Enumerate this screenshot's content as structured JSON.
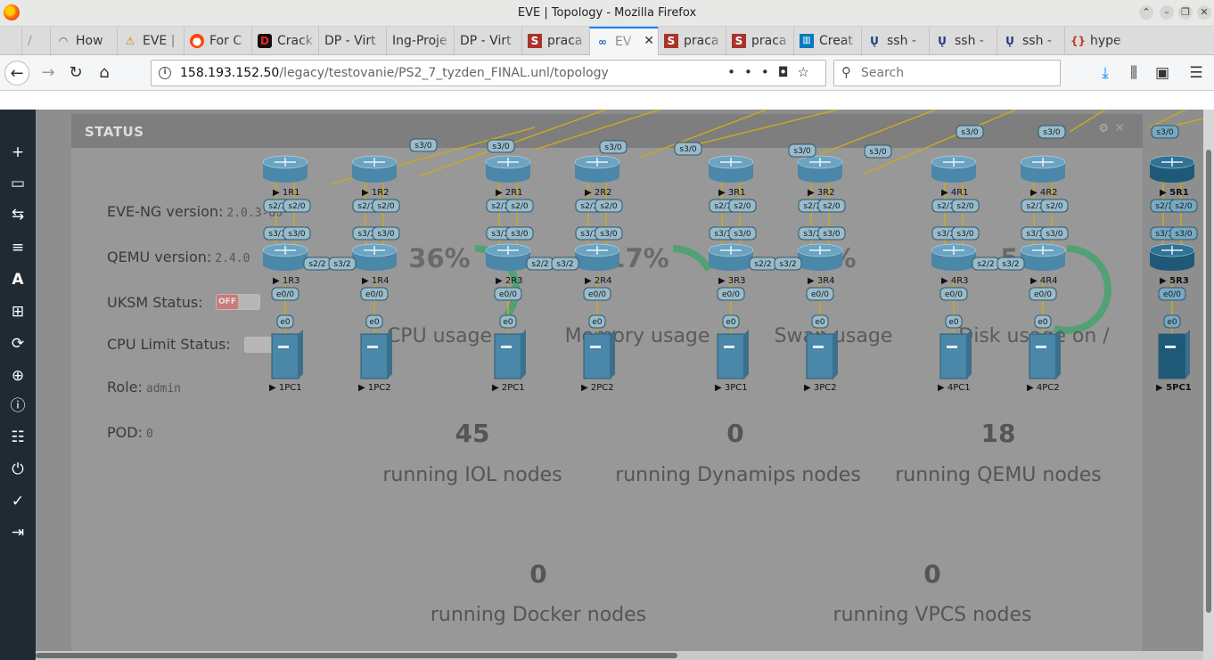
{
  "window": {
    "title": "EVE | Topology - Mozilla Firefox"
  },
  "tabs": [
    {
      "label": "How",
      "icon": "eve-icon"
    },
    {
      "label": "EVE |",
      "icon": "warning-icon"
    },
    {
      "label": "For C",
      "icon": "reddit-icon"
    },
    {
      "label": "Crack",
      "icon": "d-icon"
    },
    {
      "label": "DP - Virt",
      "icon": ""
    },
    {
      "label": "Ing-Proje",
      "icon": ""
    },
    {
      "label": "DP - Virt",
      "icon": ""
    },
    {
      "label": "praca",
      "icon": "s-icon"
    },
    {
      "label": "EV",
      "icon": "eve-icon"
    },
    {
      "label": "praca",
      "icon": "s-icon"
    },
    {
      "label": "praca",
      "icon": "s-icon"
    },
    {
      "label": "Creat",
      "icon": "trello-icon"
    },
    {
      "label": "ssh -",
      "icon": "u-icon"
    },
    {
      "label": "ssh -",
      "icon": "u-icon"
    },
    {
      "label": "ssh -",
      "icon": "u-icon"
    },
    {
      "label": "hype",
      "icon": "brace-icon"
    }
  ],
  "nav": {
    "url_host": "158.193.152.50",
    "url_path": "/legacy/testovanie/PS2_7_tyzden_FINAL.unl/topology",
    "search_placeholder": "Search"
  },
  "status": {
    "title": "STATUS",
    "eve_version_label": "EVE-NG version:",
    "eve_version": "2.0.3-86",
    "qemu_version_label": "QEMU version:",
    "qemu_version": "2.4.0",
    "uksm_label": "UKSM Status:",
    "uksm_value": "OFF",
    "cpu_limit_label": "CPU Limit Status:",
    "role_label": "Role:",
    "role": "admin",
    "pod_label": "POD:",
    "pod": "0",
    "gauges": [
      {
        "value": "36%",
        "fraction": 0.36,
        "label": "CPU usage"
      },
      {
        "value": "17%",
        "fraction": 0.17,
        "label": "Memory usage"
      },
      {
        "value": "0%",
        "fraction": 0.0,
        "label": "Swap usage"
      },
      {
        "value": "55%",
        "fraction": 0.55,
        "label": "Disk usage on /"
      }
    ],
    "counts": [
      {
        "value": "45",
        "label": "running IOL nodes"
      },
      {
        "value": "0",
        "label": "running Dynamips nodes"
      },
      {
        "value": "18",
        "label": "running QEMU nodes"
      },
      {
        "value": "0",
        "label": "running Docker nodes"
      },
      {
        "value": "0",
        "label": "running VPCS nodes"
      }
    ],
    "gauge_color": "#3ea36a"
  },
  "topology": {
    "groups": [
      {
        "r1": "1R1",
        "r2": "1R2",
        "r3": "1R3",
        "r4": "1R4",
        "pc1": "1PC1",
        "pc2": "1PC2"
      },
      {
        "r1": "2R1",
        "r2": "2R2",
        "r3": "2R3",
        "r4": "2R4",
        "pc1": "2PC1",
        "pc2": "2PC2"
      },
      {
        "r1": "3R1",
        "r2": "3R2",
        "r3": "3R3",
        "r4": "3R4",
        "pc1": "3PC1",
        "pc2": "3PC2"
      },
      {
        "r1": "4R1",
        "r2": "4R2",
        "r3": "4R3",
        "r4": "4R4",
        "pc1": "4PC1",
        "pc2": "4PC2"
      },
      {
        "r1": "5R1",
        "r3": "5R3",
        "pc1": "5PC1"
      }
    ],
    "ports": {
      "s30": "s3/0",
      "s21": "s2/1",
      "s20": "s2/0",
      "s31": "s3/1",
      "s22": "s2/2",
      "s32": "s3/2",
      "e00": "e0/0",
      "e0": "e0"
    },
    "link_color": "#c8a823"
  },
  "sidebar_icons": [
    "add-icon",
    "nodes-icon",
    "networks-icon",
    "startup-configs-icon",
    "text-icon",
    "grid-icon",
    "refresh-icon",
    "zoom-icon",
    "info-icon",
    "list-icon",
    "power-icon",
    "check-icon",
    "logout-icon"
  ]
}
